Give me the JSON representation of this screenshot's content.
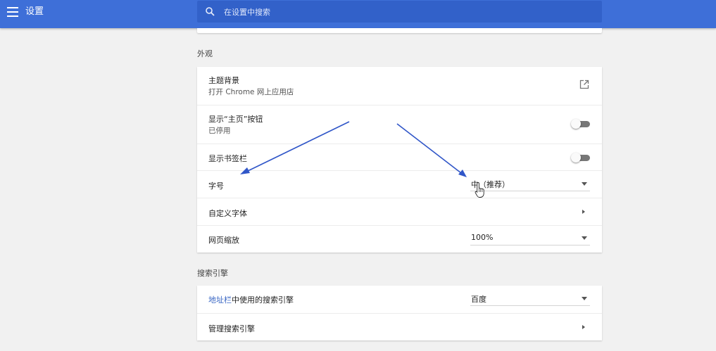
{
  "header": {
    "title": "设置",
    "search_placeholder": "在设置中搜索"
  },
  "appearance": {
    "section_title": "外观",
    "theme": {
      "label": "主题背景",
      "sublabel": "打开 Chrome 网上应用店"
    },
    "home_button": {
      "label": "显示“主页”按钮",
      "sublabel": "已停用",
      "enabled": false
    },
    "bookmarks_bar": {
      "label": "显示书签栏",
      "enabled": false
    },
    "font_size": {
      "label": "字号",
      "value": "中（推荐）"
    },
    "custom_fonts": {
      "label": "自定义字体"
    },
    "page_zoom": {
      "label": "网页缩放",
      "value": "100%"
    }
  },
  "search_engine": {
    "section_title": "搜索引擎",
    "address_bar": {
      "link_text": "地址栏",
      "label_rest": "中使用的搜索引擎",
      "value": "百度"
    },
    "manage": {
      "label": "管理搜索引擎"
    }
  },
  "colors": {
    "header_bg": "#3e6fd8",
    "search_bg": "#3261c9",
    "annotation_arrow": "#3056c8",
    "link": "#3a67c4"
  }
}
